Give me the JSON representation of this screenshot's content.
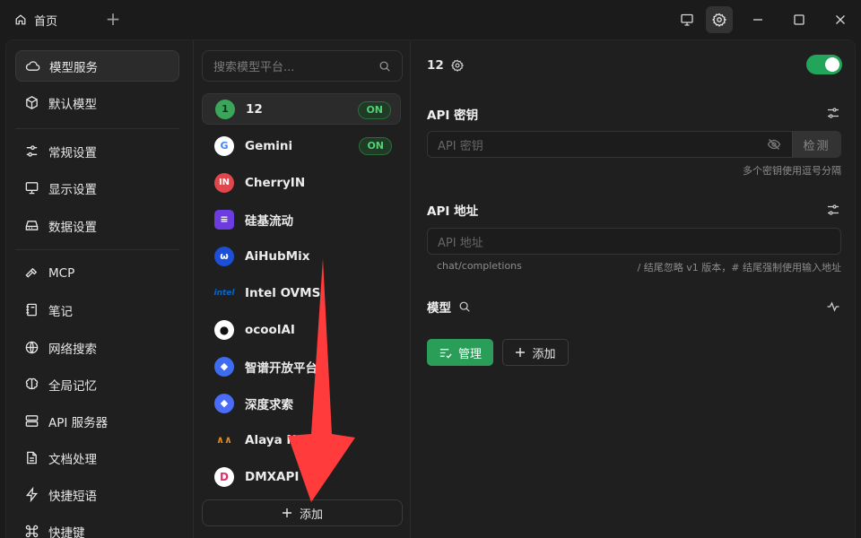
{
  "titlebar": {
    "home_tab": "首页",
    "new_tab_symbol": "+"
  },
  "nav": {
    "items": [
      {
        "label": "模型服务",
        "icon": "cloud-icon",
        "active": true
      },
      {
        "label": "默认模型",
        "icon": "cube-icon"
      },
      {
        "label": "常规设置",
        "icon": "sliders-icon"
      },
      {
        "label": "显示设置",
        "icon": "monitor-icon"
      },
      {
        "label": "数据设置",
        "icon": "drive-icon"
      },
      {
        "label": "MCP",
        "icon": "hammer-icon"
      },
      {
        "label": "笔记",
        "icon": "notebook-icon"
      },
      {
        "label": "网络搜索",
        "icon": "globe-icon"
      },
      {
        "label": "全局记忆",
        "icon": "brain-icon"
      },
      {
        "label": "API 服务器",
        "icon": "server-icon"
      },
      {
        "label": "文档处理",
        "icon": "document-icon"
      },
      {
        "label": "快捷短语",
        "icon": "zap-icon"
      },
      {
        "label": "快捷键",
        "icon": "command-icon"
      }
    ]
  },
  "providers": {
    "search_placeholder": "搜索模型平台...",
    "list": [
      {
        "name": "12",
        "icon_text": "1",
        "icon_color": "#3aa65a",
        "on": true,
        "active": true
      },
      {
        "name": "Gemini",
        "icon_text": "G",
        "icon_color": "#ffffff",
        "on": true
      },
      {
        "name": "CherryIN",
        "icon_text": "IN",
        "icon_color": "#e0474c"
      },
      {
        "name": "硅基流动",
        "icon_text": "≡",
        "icon_color": "#6c3ce0"
      },
      {
        "name": "AiHubMix",
        "icon_text": "ω",
        "icon_color": "#1c4fd6"
      },
      {
        "name": "Intel OVMS",
        "icon_text": "intel",
        "icon_color": "#0a64c8"
      },
      {
        "name": "ocoolAI",
        "icon_text": "●",
        "icon_color": "#ffffff"
      },
      {
        "name": "智谱开放平台",
        "icon_text": "◆",
        "icon_color": "#3d6cf0"
      },
      {
        "name": "深度求索",
        "icon_text": "◆",
        "icon_color": "#4b6cf7"
      },
      {
        "name": "Alaya NeW",
        "icon_text": "∧∧",
        "icon_color": "#e08a1e"
      },
      {
        "name": "DMXAPI",
        "icon_text": "D",
        "icon_color": "#ffffff"
      }
    ],
    "on_label": "ON",
    "add_label": "添加"
  },
  "detail": {
    "title": "12",
    "enabled": true,
    "api_key": {
      "label": "API 密钥",
      "placeholder": "API 密钥",
      "check_label": "检测",
      "hint": "多个密钥使用逗号分隔"
    },
    "api_url": {
      "label": "API 地址",
      "placeholder": "API 地址",
      "hint_left": "chat/completions",
      "hint_right": "/ 结尾忽略 v1 版本，# 结尾强制使用输入地址"
    },
    "models": {
      "label": "模型",
      "manage_label": "管理",
      "add_label": "添加"
    }
  },
  "colors": {
    "accent_green": "#2a9e58",
    "annotation_arrow": "#ff3b3b"
  }
}
